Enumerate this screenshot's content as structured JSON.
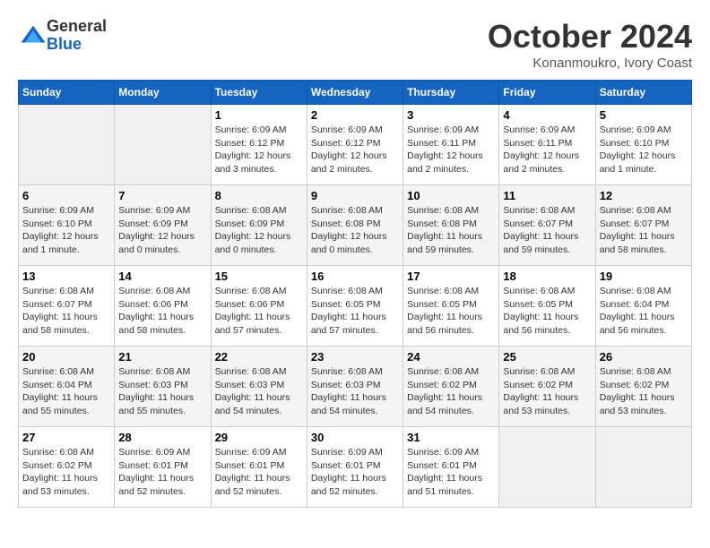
{
  "logo": {
    "general": "General",
    "blue": "Blue"
  },
  "title": "October 2024",
  "subtitle": "Konanmoukro, Ivory Coast",
  "days_of_week": [
    "Sunday",
    "Monday",
    "Tuesday",
    "Wednesday",
    "Thursday",
    "Friday",
    "Saturday"
  ],
  "weeks": [
    [
      {
        "day": "",
        "info": ""
      },
      {
        "day": "",
        "info": ""
      },
      {
        "day": "1",
        "info": "Sunrise: 6:09 AM\nSunset: 6:12 PM\nDaylight: 12 hours\nand 3 minutes."
      },
      {
        "day": "2",
        "info": "Sunrise: 6:09 AM\nSunset: 6:12 PM\nDaylight: 12 hours\nand 2 minutes."
      },
      {
        "day": "3",
        "info": "Sunrise: 6:09 AM\nSunset: 6:11 PM\nDaylight: 12 hours\nand 2 minutes."
      },
      {
        "day": "4",
        "info": "Sunrise: 6:09 AM\nSunset: 6:11 PM\nDaylight: 12 hours\nand 2 minutes."
      },
      {
        "day": "5",
        "info": "Sunrise: 6:09 AM\nSunset: 6:10 PM\nDaylight: 12 hours\nand 1 minute."
      }
    ],
    [
      {
        "day": "6",
        "info": "Sunrise: 6:09 AM\nSunset: 6:10 PM\nDaylight: 12 hours\nand 1 minute."
      },
      {
        "day": "7",
        "info": "Sunrise: 6:09 AM\nSunset: 6:09 PM\nDaylight: 12 hours\nand 0 minutes."
      },
      {
        "day": "8",
        "info": "Sunrise: 6:08 AM\nSunset: 6:09 PM\nDaylight: 12 hours\nand 0 minutes."
      },
      {
        "day": "9",
        "info": "Sunrise: 6:08 AM\nSunset: 6:08 PM\nDaylight: 12 hours\nand 0 minutes."
      },
      {
        "day": "10",
        "info": "Sunrise: 6:08 AM\nSunset: 6:08 PM\nDaylight: 11 hours\nand 59 minutes."
      },
      {
        "day": "11",
        "info": "Sunrise: 6:08 AM\nSunset: 6:07 PM\nDaylight: 11 hours\nand 59 minutes."
      },
      {
        "day": "12",
        "info": "Sunrise: 6:08 AM\nSunset: 6:07 PM\nDaylight: 11 hours\nand 58 minutes."
      }
    ],
    [
      {
        "day": "13",
        "info": "Sunrise: 6:08 AM\nSunset: 6:07 PM\nDaylight: 11 hours\nand 58 minutes."
      },
      {
        "day": "14",
        "info": "Sunrise: 6:08 AM\nSunset: 6:06 PM\nDaylight: 11 hours\nand 58 minutes."
      },
      {
        "day": "15",
        "info": "Sunrise: 6:08 AM\nSunset: 6:06 PM\nDaylight: 11 hours\nand 57 minutes."
      },
      {
        "day": "16",
        "info": "Sunrise: 6:08 AM\nSunset: 6:05 PM\nDaylight: 11 hours\nand 57 minutes."
      },
      {
        "day": "17",
        "info": "Sunrise: 6:08 AM\nSunset: 6:05 PM\nDaylight: 11 hours\nand 56 minutes."
      },
      {
        "day": "18",
        "info": "Sunrise: 6:08 AM\nSunset: 6:05 PM\nDaylight: 11 hours\nand 56 minutes."
      },
      {
        "day": "19",
        "info": "Sunrise: 6:08 AM\nSunset: 6:04 PM\nDaylight: 11 hours\nand 56 minutes."
      }
    ],
    [
      {
        "day": "20",
        "info": "Sunrise: 6:08 AM\nSunset: 6:04 PM\nDaylight: 11 hours\nand 55 minutes."
      },
      {
        "day": "21",
        "info": "Sunrise: 6:08 AM\nSunset: 6:03 PM\nDaylight: 11 hours\nand 55 minutes."
      },
      {
        "day": "22",
        "info": "Sunrise: 6:08 AM\nSunset: 6:03 PM\nDaylight: 11 hours\nand 54 minutes."
      },
      {
        "day": "23",
        "info": "Sunrise: 6:08 AM\nSunset: 6:03 PM\nDaylight: 11 hours\nand 54 minutes."
      },
      {
        "day": "24",
        "info": "Sunrise: 6:08 AM\nSunset: 6:02 PM\nDaylight: 11 hours\nand 54 minutes."
      },
      {
        "day": "25",
        "info": "Sunrise: 6:08 AM\nSunset: 6:02 PM\nDaylight: 11 hours\nand 53 minutes."
      },
      {
        "day": "26",
        "info": "Sunrise: 6:08 AM\nSunset: 6:02 PM\nDaylight: 11 hours\nand 53 minutes."
      }
    ],
    [
      {
        "day": "27",
        "info": "Sunrise: 6:08 AM\nSunset: 6:02 PM\nDaylight: 11 hours\nand 53 minutes."
      },
      {
        "day": "28",
        "info": "Sunrise: 6:09 AM\nSunset: 6:01 PM\nDaylight: 11 hours\nand 52 minutes."
      },
      {
        "day": "29",
        "info": "Sunrise: 6:09 AM\nSunset: 6:01 PM\nDaylight: 11 hours\nand 52 minutes."
      },
      {
        "day": "30",
        "info": "Sunrise: 6:09 AM\nSunset: 6:01 PM\nDaylight: 11 hours\nand 52 minutes."
      },
      {
        "day": "31",
        "info": "Sunrise: 6:09 AM\nSunset: 6:01 PM\nDaylight: 11 hours\nand 51 minutes."
      },
      {
        "day": "",
        "info": ""
      },
      {
        "day": "",
        "info": ""
      }
    ]
  ]
}
